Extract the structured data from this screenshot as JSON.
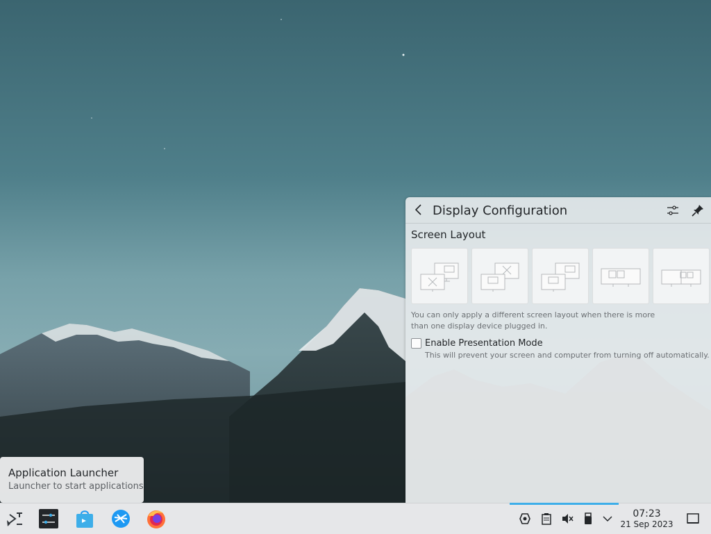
{
  "popup": {
    "title": "Display Configuration",
    "section_title": "Screen Layout",
    "layout_hint": "You can only apply a different screen layout when there is more than one display device plugged in.",
    "presentation_label": "Enable Presentation Mode",
    "presentation_desc": "This will prevent your screen and computer from turning off automatically.",
    "presentation_checked": false,
    "layout_options": [
      "external-only",
      "internal-only",
      "extend-right",
      "mirror",
      "extend-left"
    ]
  },
  "tooltip": {
    "title": "Application Launcher",
    "subtitle": "Launcher to start applications"
  },
  "panel": {
    "tasks": [
      "application-launcher-icon",
      "system-settings-icon",
      "discover-icon",
      "plasma-browser-icon",
      "firefox-icon"
    ],
    "tray": [
      "kde-connect-icon",
      "clipboard-icon",
      "volume-muted-icon",
      "removable-device-icon",
      "expand-tray-icon"
    ],
    "clock_time": "07:23",
    "clock_date": "21 Sep 2023",
    "accent": "#3daee9"
  }
}
